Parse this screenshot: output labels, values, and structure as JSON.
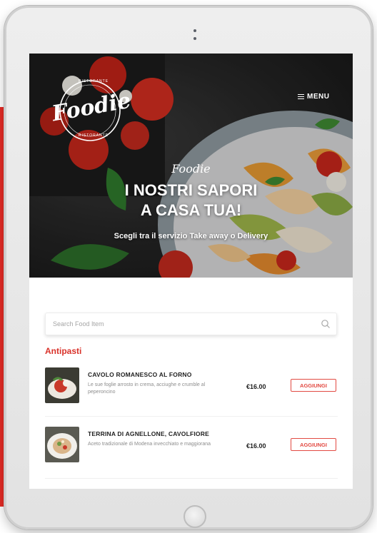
{
  "hero": {
    "logo_text": "Foodie",
    "logo_top_text": "RISTORANTE",
    "logo_bottom_text": "RISTORANTE",
    "menu_label": "MENU",
    "script": "Foodie",
    "title_line1": "I NOSTRI SAPORI",
    "title_line2": "A CASA TUA!",
    "subtitle": "Scegli tra il servizio Take away o Delivery"
  },
  "search": {
    "placeholder": "Search Food Item"
  },
  "section": {
    "title": "Antipasti"
  },
  "items": [
    {
      "name": "CAVOLO ROMANESCO AL FORNO",
      "description": "Le sue foglie arrosto in crema, acciughe e crumble al peperoncino",
      "price": "€16.00",
      "button": "AGGIUNGI"
    },
    {
      "name": "TERRINA DI AGNELLONE, CAVOLFIORE",
      "description": "Aceto tradizionale di Modena invecchiato e maggiorana",
      "price": "€16.00",
      "button": "AGGIUNGI"
    }
  ],
  "colors": {
    "accent": "#e42b25",
    "button_border": "#e24a42",
    "tablet_frame": "#e6e6e6"
  }
}
